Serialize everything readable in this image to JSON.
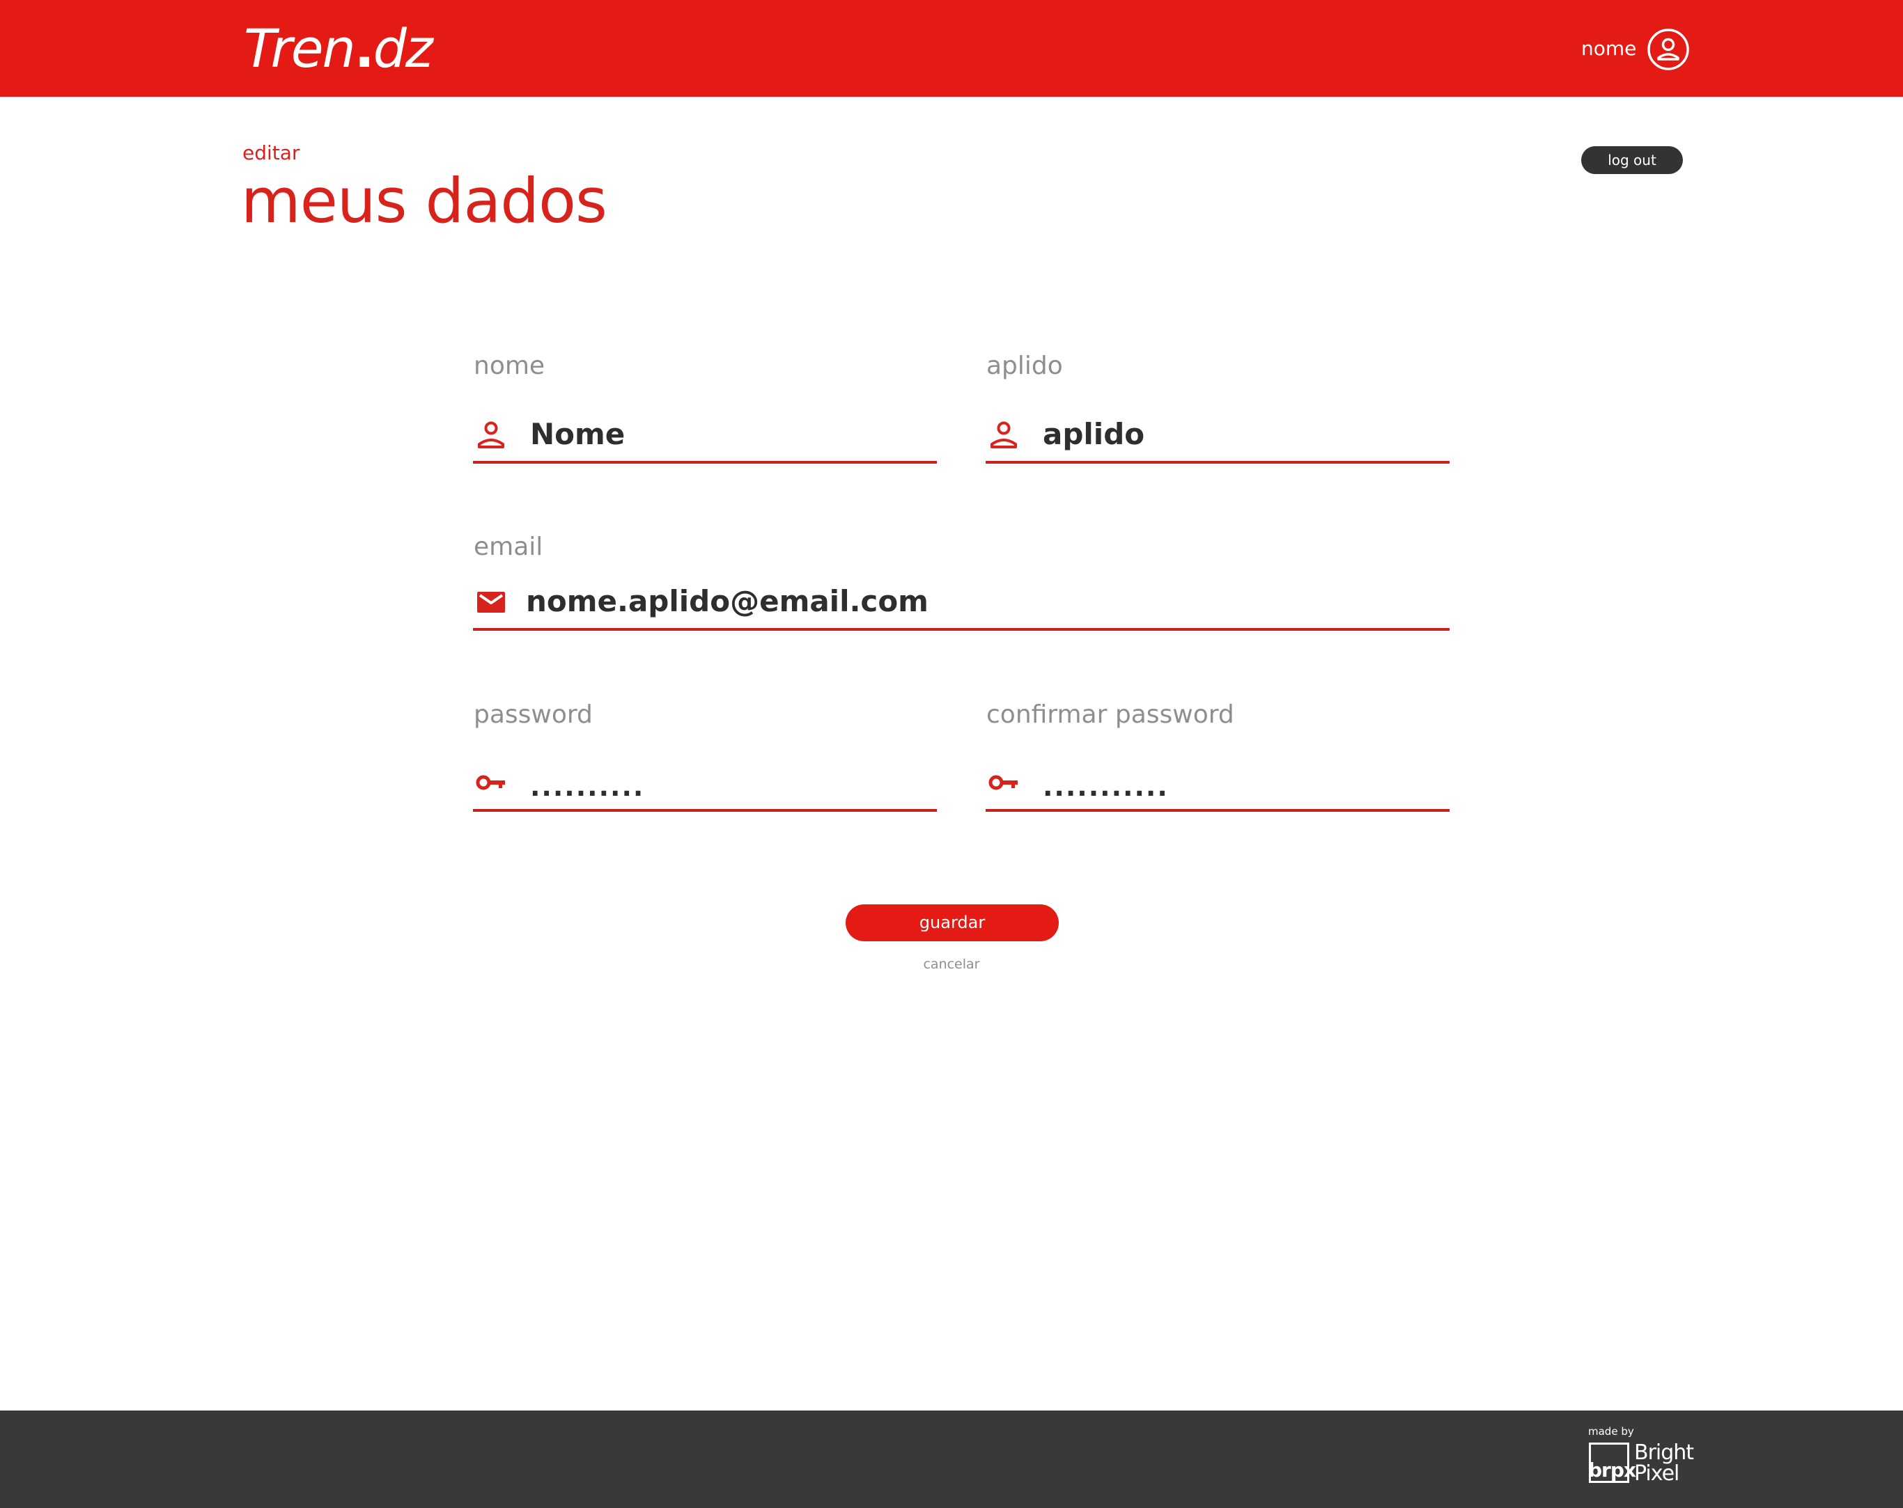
{
  "header": {
    "logo": "Tren.dz",
    "logo_main": "Tren",
    "logo_dot": ".",
    "logo_tail": "dz",
    "user_label": "nome"
  },
  "page": {
    "eyebrow": "editar",
    "title": "meus dados",
    "logout_label": "log out"
  },
  "form": {
    "nome": {
      "label": "nome",
      "value": "Nome",
      "icon": "person-icon"
    },
    "aplido": {
      "label": "aplido",
      "value": "aplido",
      "icon": "person-icon"
    },
    "email": {
      "label": "email",
      "value": "nome.aplido@email.com",
      "icon": "mail-icon"
    },
    "password": {
      "label": "password",
      "value": "..........",
      "icon": "key-icon"
    },
    "confirm_password": {
      "label": "confirmar password",
      "value": "...........",
      "icon": "key-icon"
    },
    "save_label": "guardar",
    "cancel_label": "cancelar"
  },
  "footer": {
    "made_by": "made by",
    "brand_short": "brpx",
    "brand_line1": "Bright",
    "brand_line2": "Pixel"
  },
  "colors": {
    "accent": "#e41b14",
    "dark": "#393939",
    "label_gray": "#8e8e8e"
  }
}
